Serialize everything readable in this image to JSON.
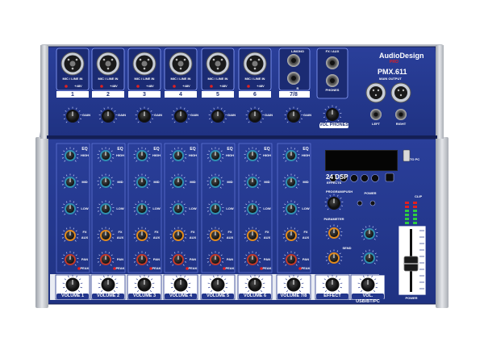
{
  "brand": {
    "name": "AudioDesign",
    "sub": "PRO",
    "model": "PMX.611"
  },
  "labels": {
    "mic_line_in": "MIC / LINE IN",
    "phantom": "+48V",
    "lr_mono": "L/MONO",
    "r": "R",
    "fx_aux": "FX / AUX",
    "phones": "PHONES",
    "main_output": "MAIN OUTPUT",
    "left": "LEFT",
    "right": "RIGHT",
    "gain": "GAIN",
    "vol_phones": "VOL PHONES",
    "eq": "EQ",
    "high": "HIGH",
    "mid": "MID",
    "low": "LOW",
    "fx": "FX",
    "aux": "AUX",
    "pan": "PAN",
    "peak": "PEAK",
    "dsp": "24 DSP",
    "effects": "EFFECTS",
    "program": "PROGRAM/PUSH",
    "power": "POWER",
    "parameter": "PARAMETER",
    "send": "SEND",
    "power_fader": "POWER",
    "to_pc": "TO PC",
    "clip": "CLIP"
  },
  "channels": [
    "1",
    "2",
    "3",
    "4",
    "5",
    "6",
    "7/8"
  ],
  "volume_labels": [
    "VOLUME 1",
    "VOLUME 2",
    "VOLUME 3",
    "VOLUME 4",
    "VOLUME 5",
    "VOLUME 6",
    "VOLUME 7/8",
    "EFFECT",
    "VOL. USB/BT/PC"
  ],
  "colors": {
    "panel": "#23368c",
    "panel_dark": "#17245f",
    "frame": "#c9ccd2",
    "knob_eq": "#2f8fb0",
    "knob_aux": "#e08a1e",
    "knob_pan": "#c0392b",
    "led_green": "#2ecc40",
    "led_red": "#e02020"
  }
}
